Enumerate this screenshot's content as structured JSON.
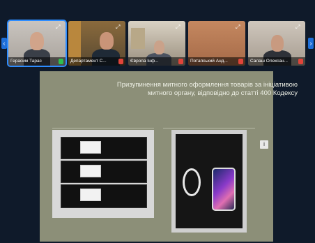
{
  "participants": [
    {
      "name": "Герасим Тарас",
      "mic": "on",
      "active": true
    },
    {
      "name": "Департамент С...",
      "mic": "off",
      "active": false
    },
    {
      "name": "Європа Інф...",
      "mic": "off",
      "active": false
    },
    {
      "name": "Потапський Анд...",
      "mic": "off",
      "active": false
    },
    {
      "name": "Салаш Олексан...",
      "mic": "off",
      "active": false
    }
  ],
  "nav": {
    "left_label": "‹",
    "right_label": "›"
  },
  "expand_label": "⤢",
  "slide": {
    "title": "Призупинення митного оформлення товарів за ініціативою митного органу, відповідно до статті 400 Кодексу",
    "corner_label": "i"
  },
  "colors": {
    "background": "#0f1a2a",
    "accent": "#2d8cff",
    "mic_on": "#2fbf4f",
    "mic_off": "#e0443a",
    "slide_bg": "#8c8f78"
  }
}
